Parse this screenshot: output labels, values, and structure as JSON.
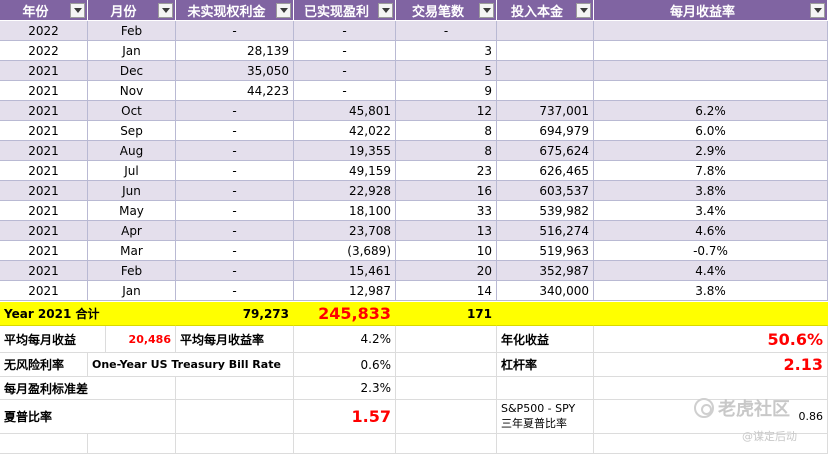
{
  "headers": [
    "年份",
    "月份",
    "未实现权利金",
    "已实现盈利",
    "交易笔数",
    "投入本金",
    "每月收益率"
  ],
  "rows": [
    {
      "year": "2022",
      "month": "Feb",
      "unrealized": "-",
      "realized": "-",
      "trades": "-",
      "capital": "",
      "rate": ""
    },
    {
      "year": "2022",
      "month": "Jan",
      "unrealized": "28,139",
      "realized": "-",
      "trades": "3",
      "capital": "",
      "rate": ""
    },
    {
      "year": "2021",
      "month": "Dec",
      "unrealized": "35,050",
      "realized": "-",
      "trades": "5",
      "capital": "",
      "rate": ""
    },
    {
      "year": "2021",
      "month": "Nov",
      "unrealized": "44,223",
      "realized": "-",
      "trades": "9",
      "capital": "",
      "rate": ""
    },
    {
      "year": "2021",
      "month": "Oct",
      "unrealized": "-",
      "realized": "45,801",
      "trades": "12",
      "capital": "737,001",
      "rate": "6.2%"
    },
    {
      "year": "2021",
      "month": "Sep",
      "unrealized": "-",
      "realized": "42,022",
      "trades": "8",
      "capital": "694,979",
      "rate": "6.0%"
    },
    {
      "year": "2021",
      "month": "Aug",
      "unrealized": "-",
      "realized": "19,355",
      "trades": "8",
      "capital": "675,624",
      "rate": "2.9%"
    },
    {
      "year": "2021",
      "month": "Jul",
      "unrealized": "-",
      "realized": "49,159",
      "trades": "23",
      "capital": "626,465",
      "rate": "7.8%"
    },
    {
      "year": "2021",
      "month": "Jun",
      "unrealized": "-",
      "realized": "22,928",
      "trades": "16",
      "capital": "603,537",
      "rate": "3.8%"
    },
    {
      "year": "2021",
      "month": "May",
      "unrealized": "-",
      "realized": "18,100",
      "trades": "33",
      "capital": "539,982",
      "rate": "3.4%"
    },
    {
      "year": "2021",
      "month": "Apr",
      "unrealized": "-",
      "realized": "23,708",
      "trades": "13",
      "capital": "516,274",
      "rate": "4.6%"
    },
    {
      "year": "2021",
      "month": "Mar",
      "unrealized": "-",
      "realized": "(3,689)",
      "trades": "10",
      "capital": "519,963",
      "rate": "-0.7%"
    },
    {
      "year": "2021",
      "month": "Feb",
      "unrealized": "-",
      "realized": "15,461",
      "trades": "20",
      "capital": "352,987",
      "rate": "4.4%"
    },
    {
      "year": "2021",
      "month": "Jan",
      "unrealized": "-",
      "realized": "12,987",
      "trades": "14",
      "capital": "340,000",
      "rate": "3.8%"
    }
  ],
  "total": {
    "label": "Year 2021 合计",
    "unrealized": "79,273",
    "realized": "245,833",
    "trades": "171"
  },
  "stats": {
    "avg_monthly_income_label": "平均每月收益",
    "avg_monthly_income_value": "20,486",
    "avg_monthly_rate_label": "平均每月收益率",
    "avg_monthly_rate_value": "4.2%",
    "annual_label": "年化收益",
    "annual_value": "50.6%",
    "riskfree_label": "无风险利率",
    "riskfree_desc": "One-Year US Treasury Bill Rate",
    "riskfree_value": "0.6%",
    "leverage_label": "杠杆率",
    "leverage_value": "2.13",
    "std_label": "每月盈利标准差",
    "std_value": "2.3%",
    "sharpe_label": "夏普比率",
    "sharpe_value": "1.57",
    "spy_label": "S&P500 - SPY",
    "spy_sub": "三年夏普比率",
    "spy_value": "0.86"
  },
  "watermark": {
    "main": "老虎社区",
    "sub": "@谋定后动"
  }
}
